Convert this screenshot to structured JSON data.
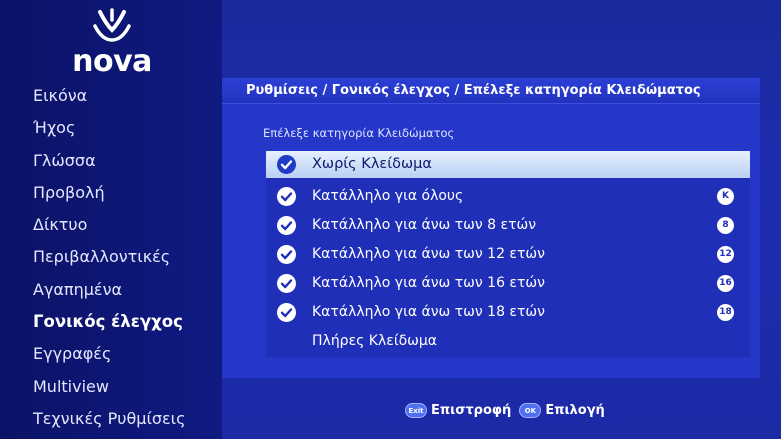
{
  "brand": {
    "logo_text": "nova"
  },
  "sidebar": {
    "items": [
      {
        "label": "Εικόνα",
        "active": false
      },
      {
        "label": "Ήχος",
        "active": false
      },
      {
        "label": "Γλώσσα",
        "active": false
      },
      {
        "label": "Προβολή",
        "active": false
      },
      {
        "label": "Δίκτυο",
        "active": false
      },
      {
        "label": "Περιβαλλοντικές",
        "active": false
      },
      {
        "label": "Αγαπημένα",
        "active": false
      },
      {
        "label": "Γονικός έλεγχος",
        "active": true
      },
      {
        "label": "Εγγραφές",
        "active": false
      },
      {
        "label": "Multiview",
        "active": false
      },
      {
        "label": "Τεχνικές Ρυθμίσεις",
        "active": false
      }
    ]
  },
  "main": {
    "breadcrumb": "Ρυθμίσεις / Γονικός έλεγχος / Επέλεξε κατηγορία Κλειδώματος",
    "subtitle": "Επέλεξε κατηγορία Κλειδώματος",
    "options": [
      {
        "label": "Χωρίς Κλείδωμα",
        "checked": true,
        "selected": true,
        "rating": ""
      },
      {
        "label": "Κατάλληλο για όλους",
        "checked": true,
        "selected": false,
        "rating": "K"
      },
      {
        "label": "Κατάλληλο για άνω των 8 ετών",
        "checked": true,
        "selected": false,
        "rating": "8"
      },
      {
        "label": "Κατάλληλο για άνω των 12 ετών",
        "checked": true,
        "selected": false,
        "rating": "12"
      },
      {
        "label": "Κατάλληλο για άνω των 16 ετών",
        "checked": true,
        "selected": false,
        "rating": "16"
      },
      {
        "label": "Κατάλληλο για άνω των 18 ετών",
        "checked": true,
        "selected": false,
        "rating": "18"
      },
      {
        "label": "Πλήρες Κλείδωμα",
        "checked": false,
        "selected": false,
        "rating": ""
      }
    ]
  },
  "footer": {
    "back_key": "Exit",
    "back_label": "Επιστροφή",
    "ok_key": "OK",
    "ok_label": "Επιλογή"
  },
  "colors": {
    "background": "#1d2db0",
    "sidebar": "#0b1266",
    "panel": "#2437c9",
    "selected_row": "#cfe0fa"
  }
}
